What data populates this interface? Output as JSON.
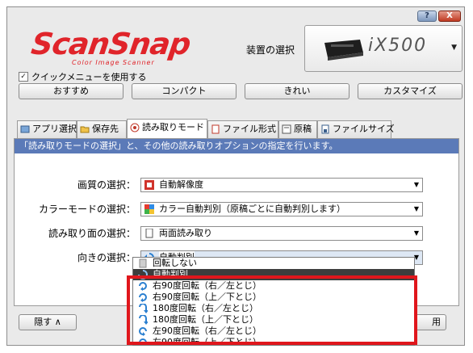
{
  "logo": {
    "title": "ScanSnap",
    "subtitle": "Color Image Scanner"
  },
  "titlebar": {
    "help": "?",
    "close": "X"
  },
  "device": {
    "label": "装置の選択",
    "model": "iX500",
    "arrow": "▼"
  },
  "quick_menu": {
    "checked": true,
    "label": "クイックメニューを使用する"
  },
  "modes": [
    "おすすめ",
    "コンパクト",
    "きれい",
    "カスタマイズ"
  ],
  "tabs": [
    {
      "label": "アプリ選択",
      "icon": "app-icon"
    },
    {
      "label": "保存先",
      "icon": "folder-icon"
    },
    {
      "label": "読み取りモード",
      "icon": "scan-mode-icon",
      "active": true
    },
    {
      "label": "ファイル形式",
      "icon": "file-format-icon"
    },
    {
      "label": "原稿",
      "icon": "paper-icon"
    },
    {
      "label": "ファイルサイズ",
      "icon": "file-size-icon"
    }
  ],
  "panel": {
    "header": "「読み取りモードの選択」と、その他の読み取りオプションの指定を行います。",
    "options": [
      {
        "label": "画質の選択：",
        "value": "自動解像度",
        "icon": "quality-icon"
      },
      {
        "label": "カラーモードの選択：",
        "value": "カラー自動判別（原稿ごとに自動判別します）",
        "icon": "color-icon"
      },
      {
        "label": "読み取り面の選択：",
        "value": "両面読み取り",
        "icon": "duplex-icon"
      },
      {
        "label": "向きの選択：",
        "value": "自動判別",
        "icon": "rotate-auto-icon"
      }
    ]
  },
  "dropdown": {
    "items": [
      {
        "label": "回転しない",
        "icon": "no-rotate-icon"
      },
      {
        "label": "自動判別",
        "icon": "rotate-auto-icon",
        "selected": true
      },
      {
        "label": "右90度回転（右／左とじ）",
        "icon": "rotate-right-icon"
      },
      {
        "label": "右90度回転（上／下とじ）",
        "icon": "rotate-right-icon"
      },
      {
        "label": "180度回転（右／左とじ）",
        "icon": "rotate-180-icon"
      },
      {
        "label": "180度回転（上／下とじ）",
        "icon": "rotate-180-icon"
      },
      {
        "label": "左90度回転（右／左とじ）",
        "icon": "rotate-left-icon"
      },
      {
        "label": "左90度回転（上／下とじ）",
        "icon": "rotate-left-icon"
      }
    ]
  },
  "bottom": {
    "hide": "隠す",
    "hide_chevron": "∧",
    "apply": "用"
  },
  "colors": {
    "accent": "#5b7ab8",
    "highlight": "#e0161c",
    "logo": "#e0242a"
  }
}
